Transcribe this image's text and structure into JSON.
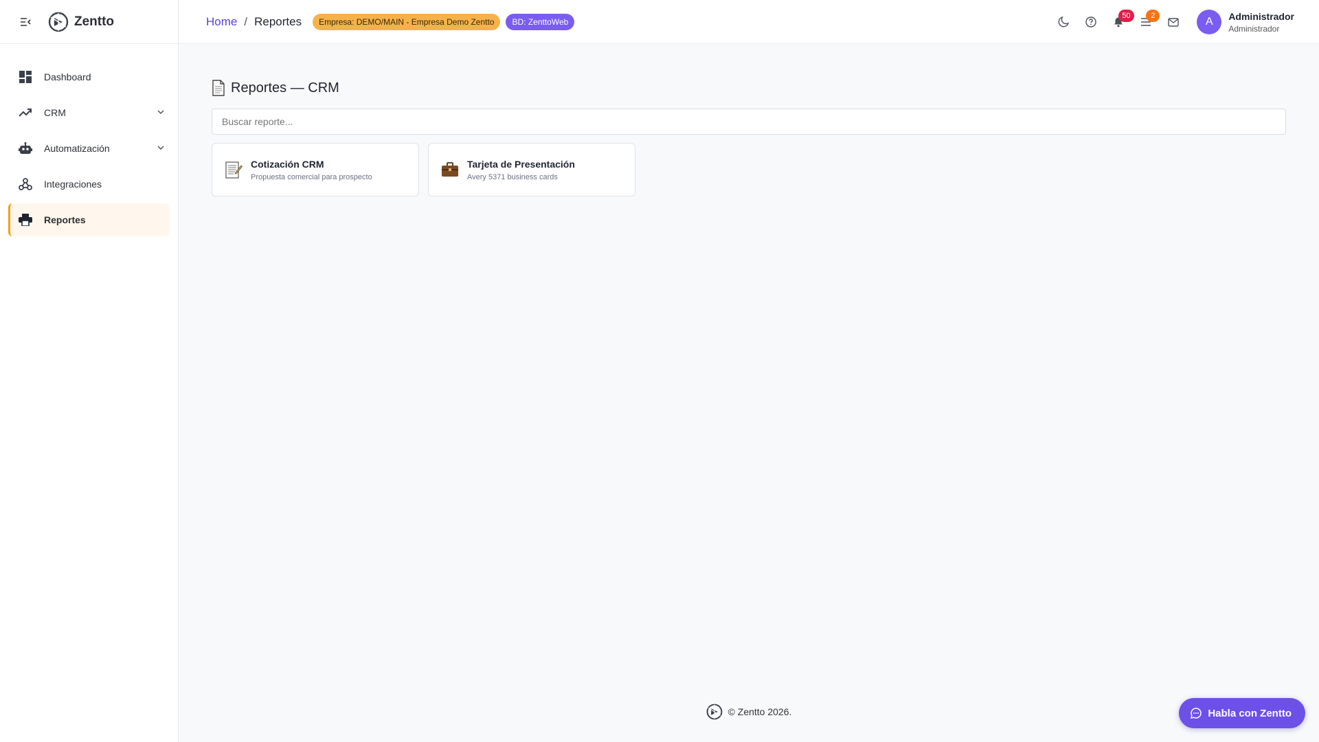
{
  "brand": {
    "name": "Zentto"
  },
  "sidebar": {
    "items": [
      {
        "label": "Dashboard"
      },
      {
        "label": "CRM"
      },
      {
        "label": "Automatización"
      },
      {
        "label": "Integraciones"
      },
      {
        "label": "Reportes"
      }
    ]
  },
  "header": {
    "breadcrumb": {
      "home": "Home",
      "separator": "/",
      "current": "Reportes"
    },
    "empresa_chip": "Empresa: DEMO/MAIN - Empresa Demo Zentto",
    "bd_chip": "BD: ZenttoWeb",
    "notifications_count": "50",
    "tasks_count": "2",
    "user": {
      "initial": "A",
      "name": "Administrador",
      "role": "Administrador"
    }
  },
  "main": {
    "title": "Reportes — CRM",
    "search_placeholder": "Buscar reporte...",
    "cards": [
      {
        "title": "Cotización CRM",
        "subtitle": "Propuesta comercial para prospecto"
      },
      {
        "title": "Tarjeta de Presentación",
        "subtitle": "Avery 5371 business cards"
      }
    ]
  },
  "footer": {
    "text": "© Zentto 2026."
  },
  "chat": {
    "label": "Habla con Zentto"
  },
  "colors": {
    "accent": "#6d50e8",
    "active_bg": "#fff7ed",
    "active_border": "#f59e0b",
    "empresa_chip": "#f6b24a",
    "bd_chip": "#7b5cf0"
  }
}
